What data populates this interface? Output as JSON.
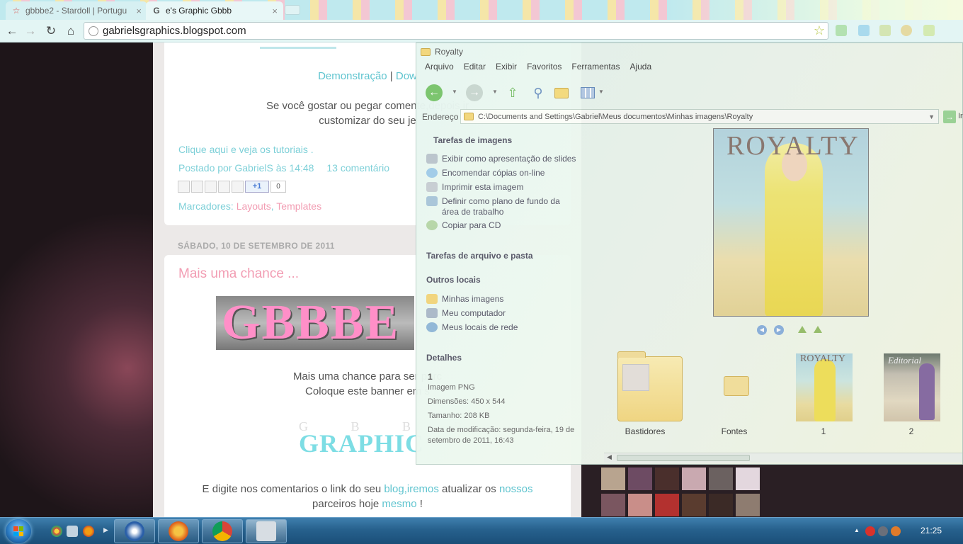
{
  "browser": {
    "tabs": [
      {
        "label": "gbbbe2 - Stardoll | Portugu",
        "active": false
      },
      {
        "label": "e's Graphic Gbbb",
        "active": true
      }
    ],
    "tab_close": "×",
    "url": "gabrielsgraphics.blogspot.com",
    "nav": {
      "back": "←",
      "forward": "→",
      "reload": "↻",
      "home": "⌂",
      "star": "☆"
    }
  },
  "blog": {
    "post1": {
      "links_line": [
        "Demonstração",
        " | ",
        "Dow"
      ],
      "body_line1": "Se você gostar ou pegar comente,depois ir",
      "body_line2": "customizar do seu je",
      "tutorial_link": "Clique aqui e veja os tutoriais .",
      "posted_by": "Postado por GabrielS às 14:48",
      "comments": "13 comentário",
      "plus1": "+1",
      "plus1_count": "0",
      "labels_prefix": "Marcadores:",
      "labels": [
        "Layouts",
        "Templates"
      ],
      "labels_sep": ", "
    },
    "date_header": "SÁBADO, 10 DE SETEMBRO DE 2011",
    "post2": {
      "title": "Mais uma chance ...",
      "banner_text": "GBBBE",
      "body_line1": "Mais uma chance para ser parc",
      "body_line2": "Coloque este banner em s",
      "logo_letters": "G B B B",
      "logo_word": "GRAPHIC",
      "footer_line1_a": "E digite nos comentarios o link do seu ",
      "footer_line1_b": "blog,iremos",
      "footer_line1_c": " atualizar os ",
      "footer_line1_d": "nossos",
      "footer_line2_a": "parceiros hoje ",
      "footer_line2_b": "mesmo",
      "footer_line2_c": " !"
    }
  },
  "explorer": {
    "title": "Royalty",
    "menu": [
      "Arquivo",
      "Editar",
      "Exibir",
      "Favoritos",
      "Ferramentas",
      "Ajuda"
    ],
    "address_label": "Endereço",
    "address": "C:\\Documents and Settings\\Gabriel\\Meus documentos\\Minhas imagens\\Royalty",
    "go_label": "Ir",
    "image_tasks_title": "Tarefas de imagens",
    "image_tasks": [
      "Exibir como apresentação de slides",
      "Encomendar cópias on-line",
      "Imprimir esta imagem",
      "Definir como plano de fundo da área de trabalho",
      "Copiar para CD"
    ],
    "file_tasks_title": "Tarefas de arquivo e pasta",
    "other_places_title": "Outros locais",
    "other_places": [
      "Minhas imagens",
      "Meu computador",
      "Meus locais de rede"
    ],
    "details_title": "Detalhes",
    "details": {
      "name": "1",
      "type": "Imagem PNG",
      "dimensions": "Dimensões: 450 x 544",
      "size": "Tamanho: 208 KB",
      "modified": "Data de modificação: segunda-feira, 19 de setembro de 2011, 16:43"
    },
    "preview_title": "ROYALTY",
    "files": [
      {
        "name": "Bastidores",
        "kind": "folder-with-content"
      },
      {
        "name": "Fontes",
        "kind": "folder"
      },
      {
        "name": "1",
        "kind": "image",
        "thumb_text": "ROYALTY"
      },
      {
        "name": "2",
        "kind": "image",
        "thumb_text": "Editorial"
      }
    ]
  },
  "taskbar": {
    "clock": "21:25"
  },
  "colors": {
    "blog_link": "#5fc4cf",
    "blog_pink": "#f29db3",
    "taskbar": "#27618d"
  }
}
